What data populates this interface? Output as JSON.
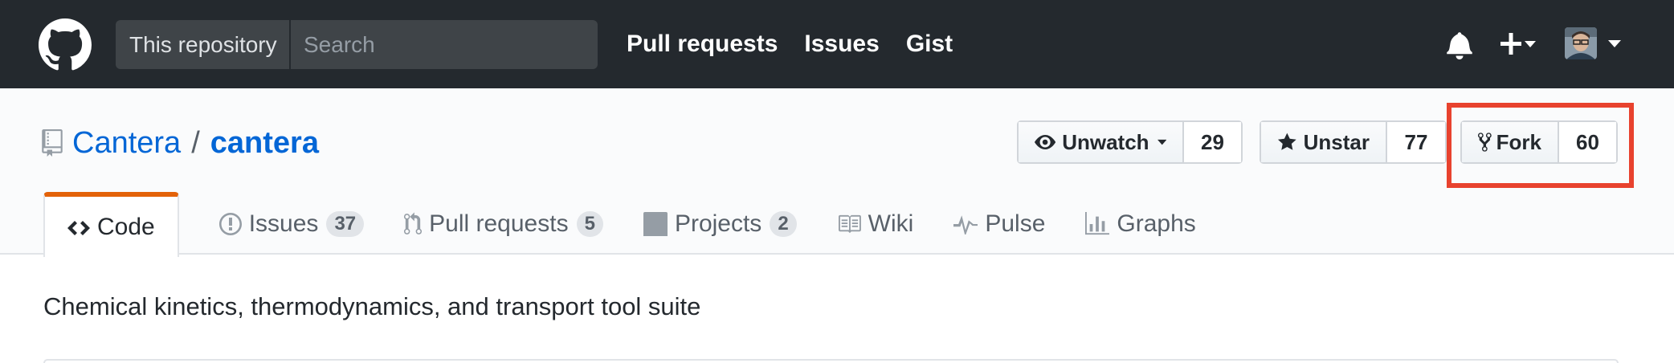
{
  "header": {
    "scope_label": "This repository",
    "search_placeholder": "Search",
    "nav": [
      "Pull requests",
      "Issues",
      "Gist"
    ]
  },
  "repo": {
    "owner": "Cantera",
    "separator": "/",
    "name": "cantera",
    "description": "Chemical kinetics, thermodynamics, and transport tool suite"
  },
  "actions": {
    "watch": {
      "label": "Unwatch",
      "count": "29"
    },
    "star": {
      "label": "Unstar",
      "count": "77"
    },
    "fork": {
      "label": "Fork",
      "count": "60"
    }
  },
  "tabs": [
    {
      "label": "Code",
      "icon": "code-icon"
    },
    {
      "label": "Issues",
      "count": "37",
      "icon": "issue-icon"
    },
    {
      "label": "Pull requests",
      "count": "5",
      "icon": "pull-request-icon"
    },
    {
      "label": "Projects",
      "count": "2",
      "icon": "project-icon"
    },
    {
      "label": "Wiki",
      "icon": "book-icon"
    },
    {
      "label": "Pulse",
      "icon": "pulse-icon"
    },
    {
      "label": "Graphs",
      "icon": "graph-icon"
    }
  ],
  "colors": {
    "header_bg": "#24292e",
    "link": "#0366d6",
    "active_tab_accent": "#e36209",
    "highlight": "#e8422e"
  }
}
